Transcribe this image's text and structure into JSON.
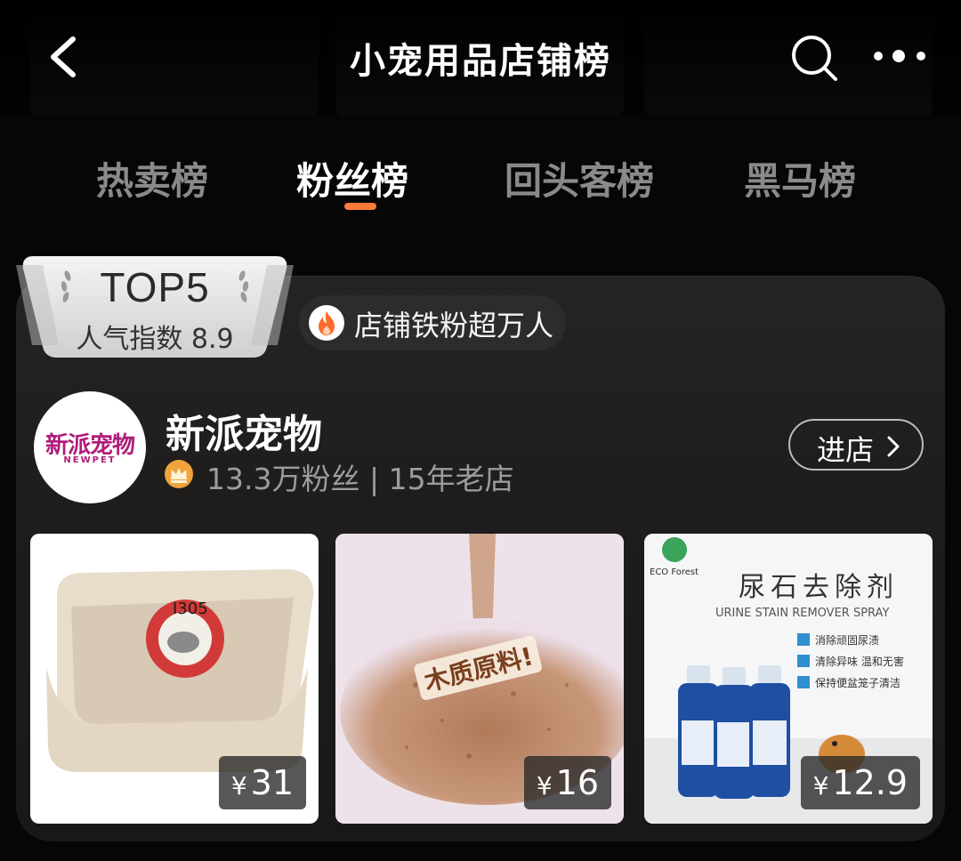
{
  "header": {
    "title": "小宠用品店铺榜"
  },
  "tabs": [
    {
      "label": "热卖榜",
      "active": false
    },
    {
      "label": "粉丝榜",
      "active": true
    },
    {
      "label": "回头客榜",
      "active": false
    },
    {
      "label": "黑马榜",
      "active": false
    }
  ],
  "card": {
    "rank_badge": {
      "rank": "TOP5",
      "popularity": "人气指数 8.9"
    },
    "fan_chip": "店铺铁粉超万人",
    "store": {
      "name": "新派宠物",
      "logo_cn": "新派宠物",
      "logo_en": "NEWPET",
      "meta": "13.3万粉丝 | 15年老店"
    },
    "enter_button": "进店",
    "products": [
      {
        "symbol": "¥",
        "price": "31",
        "overlay": "I305"
      },
      {
        "symbol": "¥",
        "price": "16",
        "overlay": "木质原料!"
      },
      {
        "symbol": "¥",
        "price": "12.9",
        "overlay_title": "尿石去除剂",
        "overlay_sub": "URINE STAIN REMOVER SPRAY",
        "overlay_brand": "ECO Forest",
        "features": [
          "消除顽固尿渍",
          "清除异味 温和无害",
          "保持便盆笼子清洁"
        ]
      }
    ]
  },
  "colors": {
    "accent": "#ff7a3a",
    "background": "#060606",
    "card": "#232120"
  }
}
